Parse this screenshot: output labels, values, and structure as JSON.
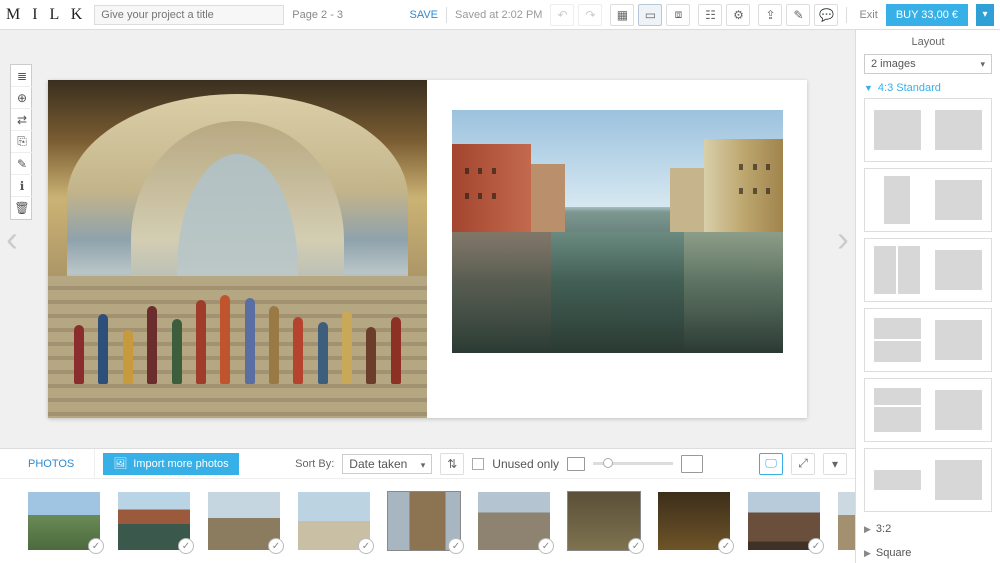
{
  "header": {
    "logo": "M I L K",
    "title_placeholder": "Give your project a title",
    "page_label": "Page 2 - 3",
    "save": "SAVE",
    "saved_at": "Saved at 2:02 PM",
    "exit": "Exit",
    "buy": "BUY 33,00 €"
  },
  "panel": {
    "title": "Layout",
    "images_select": "2 images",
    "sections": {
      "standard": "4:3 Standard",
      "ratio32": "3:2",
      "square": "Square"
    }
  },
  "tray": {
    "tab": "PHOTOS",
    "import": "Import more photos",
    "sort_label": "Sort By:",
    "sort_value": "Date taken",
    "unused_only": "Unused only"
  },
  "thumbs": [
    {
      "cls": "th0",
      "sel": false
    },
    {
      "cls": "th1",
      "sel": false
    },
    {
      "cls": "th2",
      "sel": false
    },
    {
      "cls": "th3",
      "sel": false
    },
    {
      "cls": "th4",
      "sel": true
    },
    {
      "cls": "th5",
      "sel": false
    },
    {
      "cls": "th6",
      "sel": true
    },
    {
      "cls": "th7",
      "sel": false
    },
    {
      "cls": "th8",
      "sel": false
    },
    {
      "cls": "th9",
      "sel": false
    }
  ]
}
